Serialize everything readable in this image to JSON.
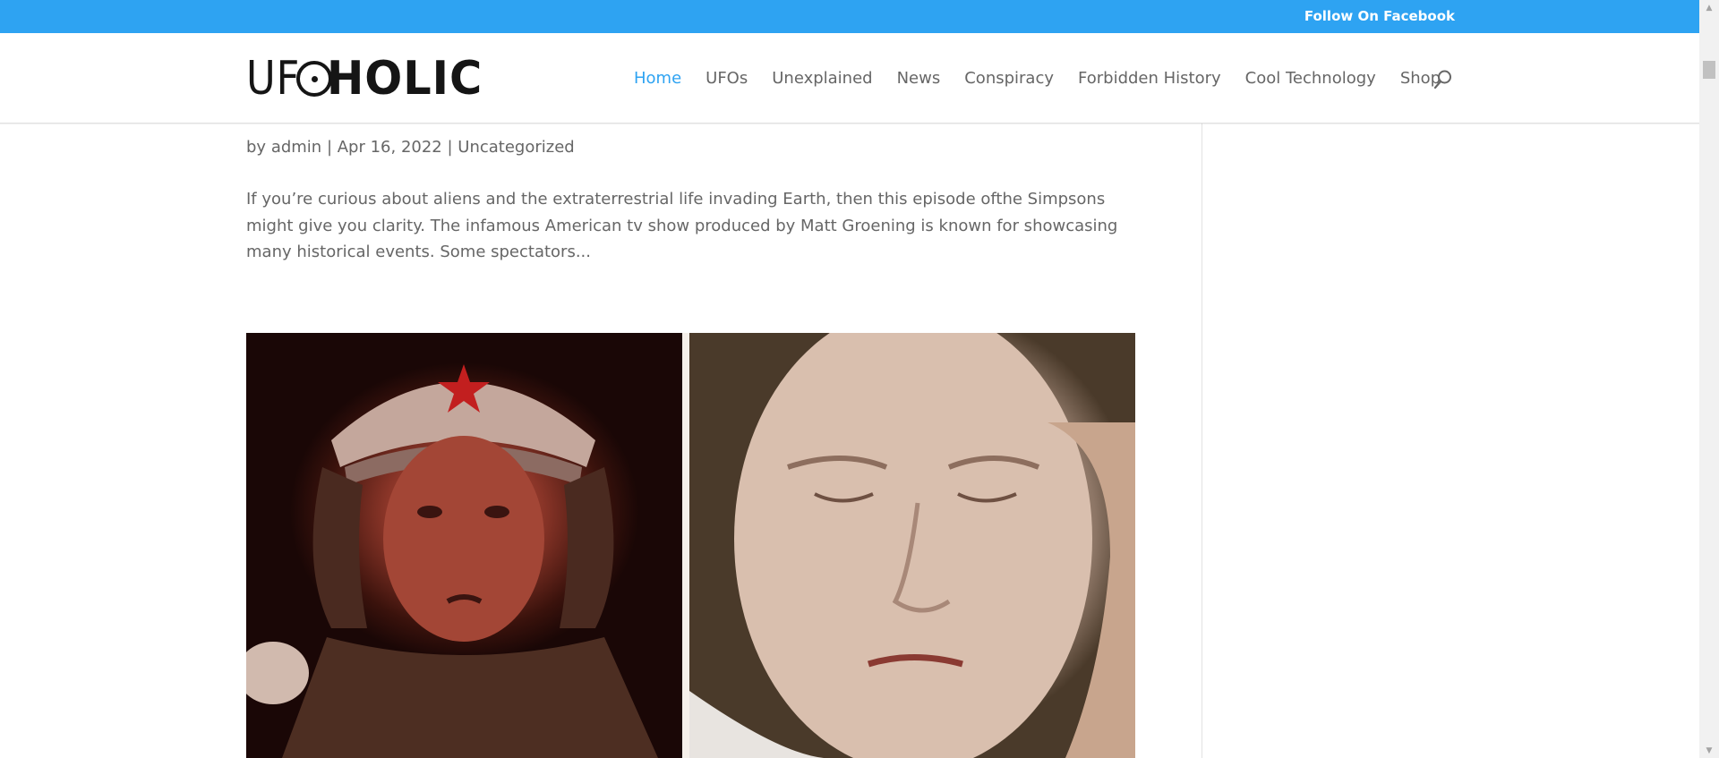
{
  "topbar": {
    "follow_label": "Follow On Facebook"
  },
  "header": {
    "logo": {
      "light_text": "UF",
      "bold_text": "HOLIC"
    },
    "nav": [
      {
        "label": "Home",
        "active": true
      },
      {
        "label": "UFOs",
        "active": false
      },
      {
        "label": "Unexplained",
        "active": false
      },
      {
        "label": "News",
        "active": false
      },
      {
        "label": "Conspiracy",
        "active": false
      },
      {
        "label": "Forbidden History",
        "active": false
      },
      {
        "label": "Cool Technology",
        "active": false
      },
      {
        "label": "Shop",
        "active": false
      }
    ],
    "search_icon": "search-icon"
  },
  "post": {
    "meta": {
      "by": "by",
      "author": "admin",
      "sep1": " | ",
      "date": "Apr 16, 2022",
      "sep2": " | ",
      "category": "Uncategorized"
    },
    "excerpt": "If you’re curious about aliens and the extraterrestrial life invading Earth, then this episode ofthe Simpsons might give you clarity. The infamous American tv show produced by Matt Groening is known for showcasing many historical events. Some spectators..."
  },
  "colors": {
    "accent": "#2ea3f2",
    "text": "#666666",
    "logo": "#151515"
  }
}
